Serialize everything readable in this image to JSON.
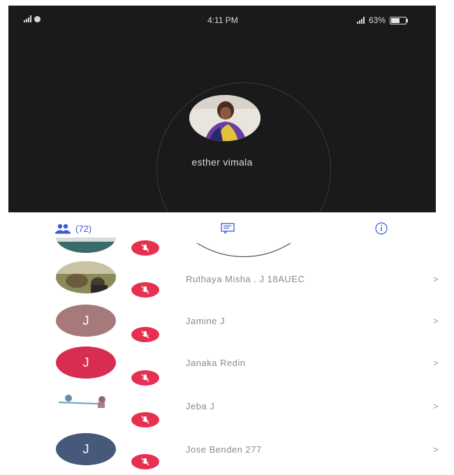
{
  "status_bar": {
    "time": "4:11 PM",
    "battery": "63%"
  },
  "speaker": {
    "name": "esther vimala",
    "avatar": "photo"
  },
  "tabs": {
    "participants_count": "(72)",
    "participants_icon": "people-icon",
    "chat_icon": "chat-icon",
    "info_icon": "info-icon"
  },
  "participants": [
    {
      "name": "",
      "avatar": "photo",
      "muted": true
    },
    {
      "name": "Ruthaya Misha . J 18AUEC",
      "avatar": "photo",
      "muted": true
    },
    {
      "name": "Jamine J",
      "avatar": "J",
      "avatar_color": "#a67a7a",
      "muted": true
    },
    {
      "name": "Janaka Redin",
      "avatar": "J",
      "avatar_color": "#d82c50",
      "muted": true
    },
    {
      "name": "Jeba J",
      "avatar": "photo",
      "muted": true
    },
    {
      "name": "Jose Benden 277",
      "avatar": "J",
      "avatar_color": "#46597a",
      "muted": true
    }
  ],
  "chevron": ">",
  "colors": {
    "accent": "#3b5ad6",
    "mute_badge": "#e53050",
    "video_bg": "#1a1a1a"
  }
}
